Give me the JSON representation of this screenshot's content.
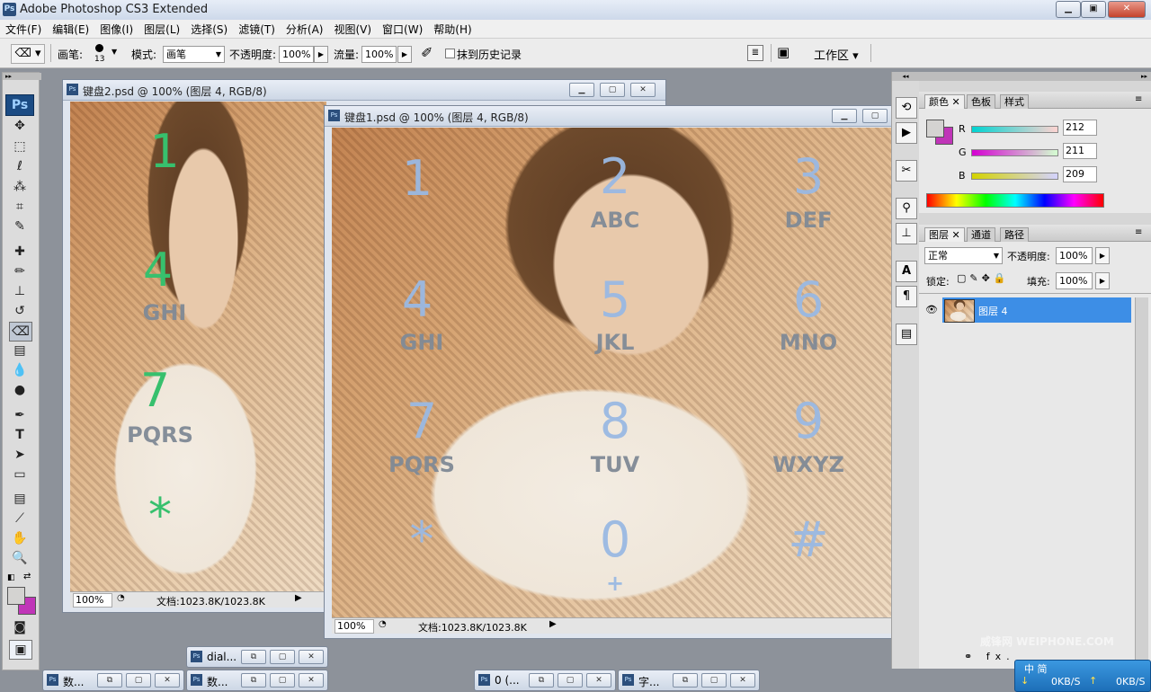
{
  "app": {
    "title": "Adobe Photoshop CS3 Extended",
    "ps_badge": "Ps",
    "win_min": "▁",
    "win_max": "▣",
    "win_close": "✕"
  },
  "menu": [
    "文件(F)",
    "编辑(E)",
    "图像(I)",
    "图层(L)",
    "选择(S)",
    "滤镜(T)",
    "分析(A)",
    "视图(V)",
    "窗口(W)",
    "帮助(H)"
  ],
  "options": {
    "brush_label": "画笔:",
    "brush_size": "13",
    "mode_label": "模式:",
    "mode_value": "画笔",
    "opacity_label": "不透明度:",
    "opacity_value": "100%",
    "flow_label": "流量:",
    "flow_value": "100%",
    "erase_history_label": "抹到历史记录",
    "workspace_label": "工作区"
  },
  "doc2": {
    "title": "键盘2.psd @ 100% (图层 4, RGB/8)",
    "keys": [
      {
        "num": "1",
        "letters": ""
      },
      {
        "num": "4",
        "letters": "GHI"
      },
      {
        "num": "7",
        "letters": "PQRS"
      },
      {
        "num": "*",
        "letters": ""
      }
    ],
    "zoom": "100%",
    "doc_info": "文档:1023.8K/1023.8K"
  },
  "doc1": {
    "title": "键盘1.psd @ 100% (图层 4, RGB/8)",
    "keys": [
      {
        "num": "1",
        "letters": ""
      },
      {
        "num": "2",
        "letters": "ABC"
      },
      {
        "num": "3",
        "letters": "DEF"
      },
      {
        "num": "4",
        "letters": "GHI"
      },
      {
        "num": "5",
        "letters": "JKL"
      },
      {
        "num": "6",
        "letters": "MNO"
      },
      {
        "num": "7",
        "letters": "PQRS"
      },
      {
        "num": "8",
        "letters": "TUV"
      },
      {
        "num": "9",
        "letters": "WXYZ"
      },
      {
        "num": "*",
        "letters": ""
      },
      {
        "num": "0",
        "letters": "+"
      },
      {
        "num": "#",
        "letters": ""
      }
    ],
    "zoom": "100%",
    "doc_info": "文档:1023.8K/1023.8K"
  },
  "color_panel": {
    "tabs": [
      "颜色",
      "色板",
      "样式"
    ],
    "r_label": "R",
    "r_value": "212",
    "g_label": "G",
    "g_value": "211",
    "b_label": "B",
    "b_value": "209",
    "fg_color": "#d4d3d1",
    "bg_color": "#c035b8"
  },
  "layers_panel": {
    "tabs": [
      "图层",
      "通道",
      "路径"
    ],
    "blend_mode": "正常",
    "opacity_label": "不透明度:",
    "opacity_value": "100%",
    "lock_label": "锁定:",
    "fill_label": "填充:",
    "fill_value": "100%",
    "layer_name": "图层 4"
  },
  "minimized_docs": [
    {
      "title": "dial..."
    },
    {
      "title": "数..."
    },
    {
      "title": "数..."
    },
    {
      "title": "0 (..."
    },
    {
      "title": "字..."
    }
  ],
  "net_widget": {
    "down": "0KB/S",
    "up": "0KB/S",
    "label": "中 简"
  },
  "watermark": "威锋网 WEIPHONE.COM"
}
